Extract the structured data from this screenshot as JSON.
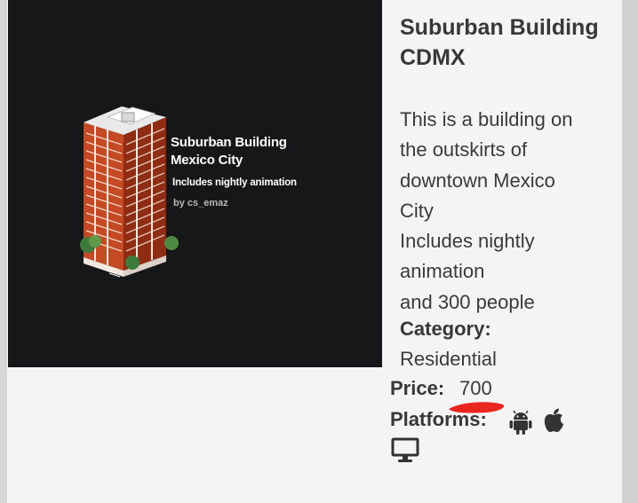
{
  "thumbnail": {
    "title_line1": "Suburban Building",
    "title_line2": "Mexico City",
    "subtitle": "Includes nightly animation",
    "author": "by cs_emaz"
  },
  "product": {
    "title": "Suburban Building CDMX",
    "description_lines": [
      "This is a building on",
      "the outskirts of",
      "downtown Mexico",
      "City",
      "Includes nightly",
      "animation",
      "and 300 people"
    ],
    "category_label": "Category:",
    "category_value": "Residential",
    "price_label": "Price:",
    "price_value": "700",
    "platforms_label": "Platforms:",
    "platforms": [
      "android-icon",
      "apple-icon",
      "desktop-icon"
    ]
  },
  "colors": {
    "thumbnail_bg": "#161719",
    "building_red": "#a8361a",
    "highlight_red": "#e8251f",
    "text_dark": "#383838"
  }
}
